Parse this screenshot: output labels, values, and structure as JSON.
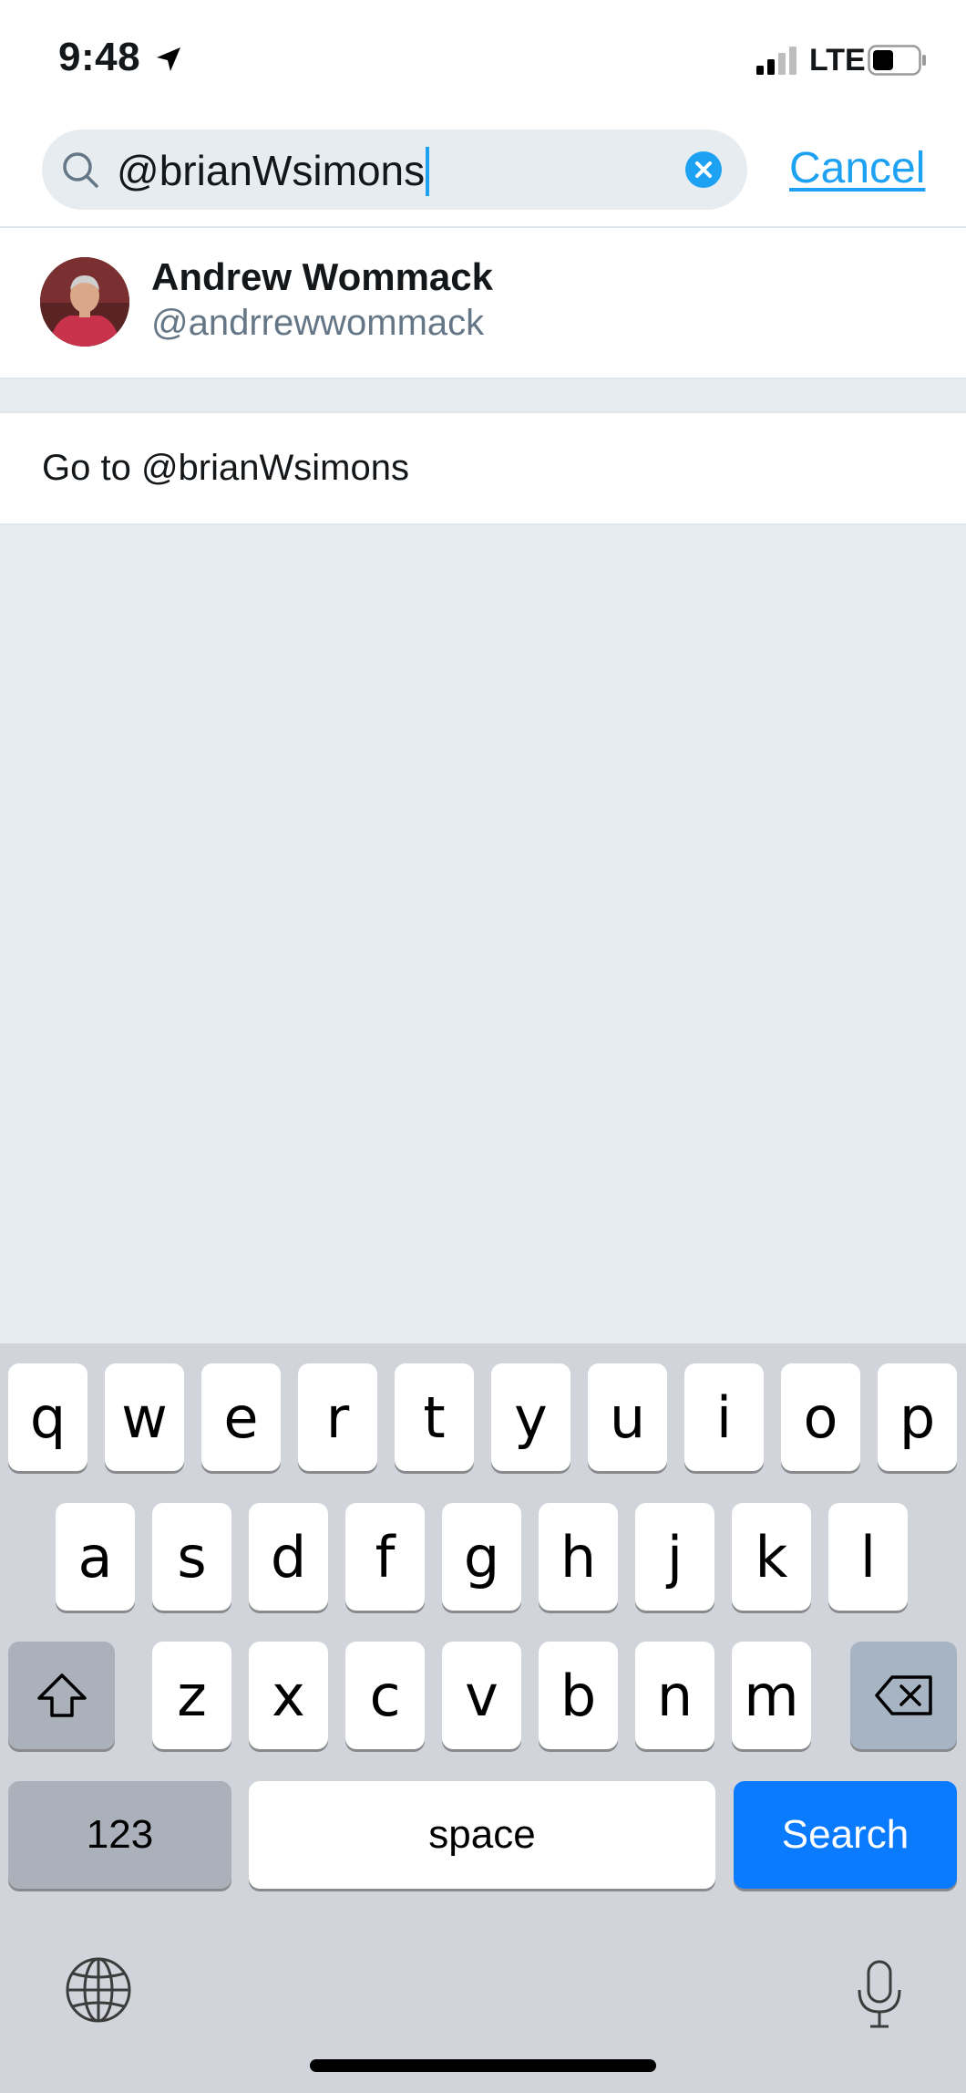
{
  "status_bar": {
    "time": "9:48",
    "network": "LTE"
  },
  "search": {
    "query": "@brianWsimons",
    "cancel_label": "Cancel"
  },
  "results": [
    {
      "name": "Andrew Wommack",
      "handle": "@andrrewwommack"
    }
  ],
  "goto": {
    "label": "Go to @brianWsimons"
  },
  "keyboard": {
    "row1": [
      "q",
      "w",
      "e",
      "r",
      "t",
      "y",
      "u",
      "i",
      "o",
      "p"
    ],
    "row2": [
      "a",
      "s",
      "d",
      "f",
      "g",
      "h",
      "j",
      "k",
      "l"
    ],
    "row3": [
      "z",
      "x",
      "c",
      "v",
      "b",
      "n",
      "m"
    ],
    "numbers_label": "123",
    "space_label": "space",
    "search_label": "Search"
  },
  "colors": {
    "accent": "#1da1f2",
    "search_key": "#0a7aff",
    "background": "#e6ecf0"
  },
  "icons": [
    "location-arrow-icon",
    "signal-icon",
    "battery-icon",
    "search-icon",
    "clear-icon",
    "shift-icon",
    "delete-icon",
    "globe-icon",
    "microphone-icon"
  ]
}
